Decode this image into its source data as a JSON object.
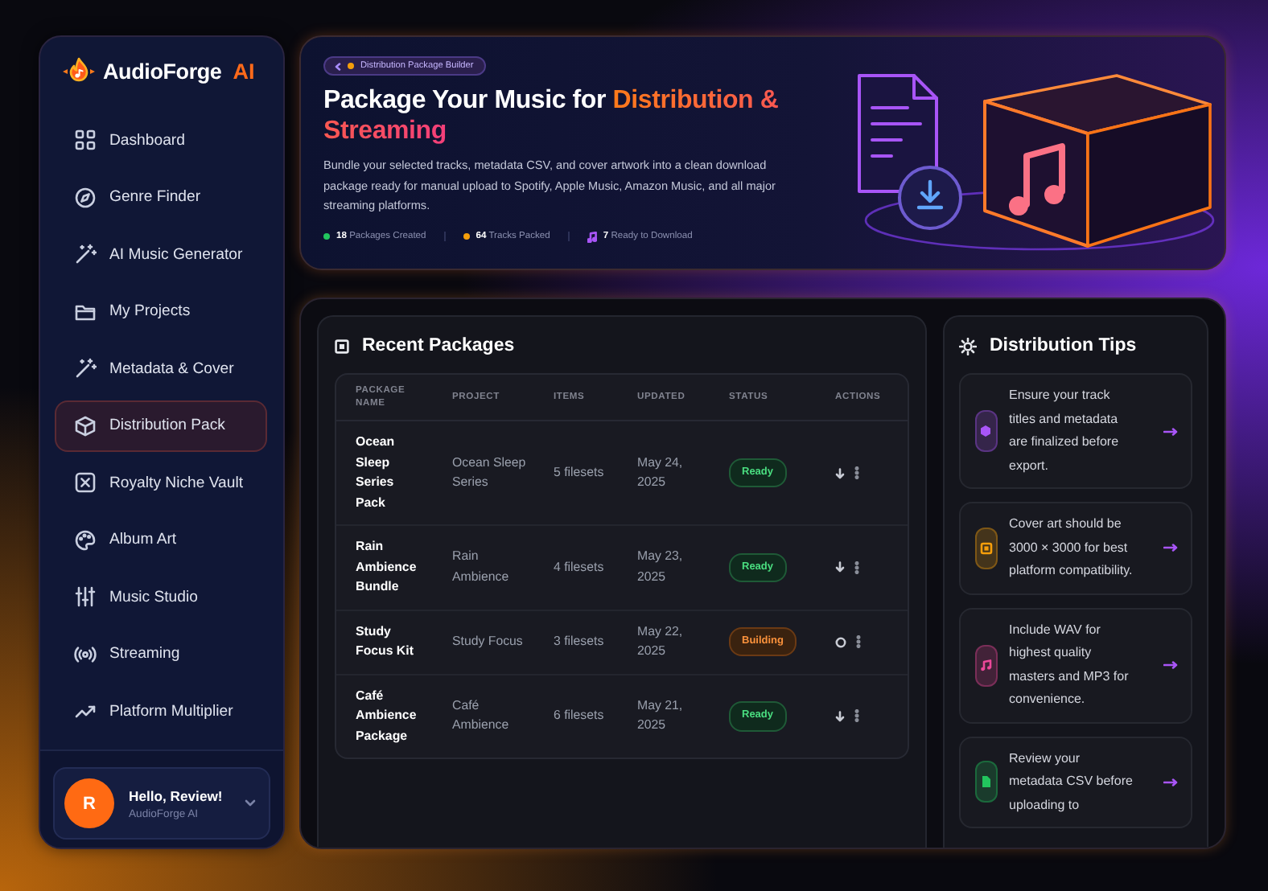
{
  "brand": {
    "name": "AudioForge",
    "accent": "AI"
  },
  "sidebar": {
    "items": [
      {
        "label": "Dashboard",
        "selected": false
      },
      {
        "label": "Genre Finder",
        "selected": false
      },
      {
        "label": "AI Music Generator",
        "selected": false
      },
      {
        "label": "My Projects",
        "selected": false
      },
      {
        "label": "Metadata & Cover",
        "selected": false
      },
      {
        "label": "Distribution Pack",
        "selected": true
      },
      {
        "label": "Royalty Niche Vault",
        "selected": false
      },
      {
        "label": "Album Art",
        "selected": false
      },
      {
        "label": "Music Studio",
        "selected": false
      },
      {
        "label": "Streaming",
        "selected": false
      },
      {
        "label": "Platform Multiplier",
        "selected": false
      }
    ]
  },
  "user": {
    "avatar": "R",
    "greeting": "Hello, Review!",
    "subtitle": "AudioForge AI"
  },
  "hero": {
    "badge": "Distribution Package Builder",
    "title": "Package Your Music for",
    "title_highlight": "Distribution & Streaming",
    "description": "Bundle your selected tracks, metadata CSV, and cover artwork into a clean download package ready for manual upload to Spotify, Apple Music, Amazon Music, and all major streaming platforms.",
    "stats": [
      {
        "kind": "dot",
        "value": "18",
        "label": "Packages Created",
        "color": "#22c55e"
      },
      {
        "kind": "dot",
        "value": "64",
        "label": "Tracks Packed",
        "color": "#f59e0b"
      },
      {
        "kind": "note",
        "value": "7",
        "label": "Ready to Download",
        "color": "#a855f7"
      }
    ]
  },
  "packages": {
    "title": "Recent Packages",
    "columns": [
      "PACKAGE NAME",
      "PROJECT",
      "ITEMS",
      "UPDATED",
      "STATUS",
      "ACTIONS"
    ],
    "rows": [
      {
        "name": "Ocean Sleep Series Pack",
        "project": "Ocean Sleep Series",
        "items": "5 filesets",
        "updated": "May 24, 2025",
        "status": {
          "kind": "ready",
          "label": "Ready"
        }
      },
      {
        "name": "Rain Ambience Bundle",
        "project": "Rain Ambience",
        "items": "4 filesets",
        "updated": "May 23, 2025",
        "status": {
          "kind": "ready",
          "label": "Ready"
        }
      },
      {
        "name": "Study Focus Kit",
        "project": "Study Focus",
        "items": "3 filesets",
        "updated": "May 22, 2025",
        "status": {
          "kind": "building",
          "label": "Building"
        }
      },
      {
        "name": "Café Ambience Package",
        "project": "Café Ambience",
        "items": "6 filesets",
        "updated": "May 21, 2025",
        "status": {
          "kind": "ready",
          "label": "Ready"
        }
      }
    ]
  },
  "tips": {
    "title": "Distribution Tips",
    "items": [
      {
        "text": "Ensure your track titles and metadata are finalized before export.",
        "color": "#a855f7"
      },
      {
        "text": "Cover art should be 3000 × 3000 for best platform compatibility.",
        "color": "#f59e0b"
      },
      {
        "text": "Include WAV for highest quality masters and MP3 for convenience.",
        "color": "#ec4899"
      },
      {
        "text": "Review your metadata CSV before uploading to",
        "color": "#22c55e"
      }
    ]
  }
}
